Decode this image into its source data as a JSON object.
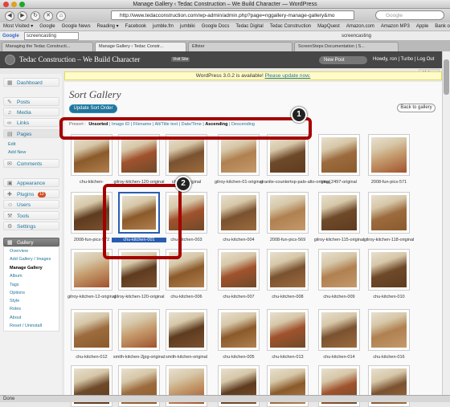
{
  "window": {
    "title": "Manage Gallery ‹ Tedac Construction – We Build Character — WordPress"
  },
  "browser": {
    "url": "http://www.tedacconstruction.com/wp-admin/admin.php?page=nggallery-manage-gallery&mo",
    "search_placeholder": "Google",
    "bookmarks": [
      "Most Visited ▾",
      "Google",
      "Google News",
      "Reading ▾",
      "Facebook",
      "jumble.fm",
      "jumbiki",
      "Google Docs",
      "Tedac Digital",
      "Tedac Construction",
      "MapQuest",
      "Amazon.com",
      "Amazon MP3",
      "Apple",
      "Bank of America"
    ],
    "google_bar": {
      "label": "Google",
      "search": "screencasting",
      "text": "screencasting"
    },
    "tabs": [
      "Managing the Tedac Constructi...",
      "Manage Gallery ‹ Tedac Constr...",
      "Elfster",
      "ScreenSteps Documentation | S..."
    ],
    "status": "Done"
  },
  "wp": {
    "site_title": "Tedac Construction – We Build Character",
    "visit_site": "Visit Site",
    "new_post": "New Post",
    "howdy": "Howdy, ron | Turbo | Log Out",
    "help": "Help ▾",
    "notice_text": "WordPress 3.0.2 is available!",
    "notice_link": "Please update now."
  },
  "sidebar": {
    "dashboard": "Dashboard",
    "posts": "Posts",
    "media": "Media",
    "links": "Links",
    "pages": "Pages",
    "pages_sub": [
      "Edit",
      "Add New"
    ],
    "comments": "Comments",
    "appearance": "Appearance",
    "plugins": "Plugins",
    "plugins_badge": "13",
    "users": "Users",
    "tools": "Tools",
    "settings": "Settings",
    "gallery": "Gallery",
    "gallery_sub": [
      "Overview",
      "Add Gallery / Images",
      "Manage Gallery",
      "Album",
      "Tags",
      "Options",
      "Style",
      "Roles",
      "About",
      "Reset / Uninstall"
    ]
  },
  "page": {
    "title": "Sort Gallery",
    "update_button": "Update Sort Order",
    "back_button": "Back to gallery",
    "sort_options": [
      "Presort :",
      "Unsorted",
      "Image ID",
      "Filename",
      "Alt/Title text",
      "Date/Time",
      "Ascending",
      "Descending"
    ]
  },
  "callouts": [
    "1",
    "2"
  ],
  "gallery": [
    "chu-kitchen-",
    "gilroy-kitchen-120-original",
    "chu-55-original",
    "gilroy-kitchen-01-original",
    "granite-countertop-palo-alto-original",
    "img_2497-original",
    "2008-fun-pics-571",
    "2008-fun-pics-572",
    "chu-kitchen-001",
    "chu-kitchen-003",
    "chu-kitchen-004",
    "2008-fun-pics-569",
    "gilroy-kitchen-115-original",
    "gilroy-kitchen-118-original",
    "gilroy-kitchen-12-original",
    "gilroy-kitchen-120-original",
    "chu-kitchen-006",
    "chu-kitchen-007",
    "chu-kitchen-008",
    "chu-kitchen-009",
    "chu-kitchen-010",
    "chu-kitchen-012",
    "smith-kitchen-2jpg-original",
    "smith-kitchen-original",
    "chu-kitchen-005",
    "chu-kitchen-013",
    "chu-kitchen-014",
    "chu-kitchen-016",
    "",
    "",
    "",
    "",
    "",
    "",
    ""
  ]
}
